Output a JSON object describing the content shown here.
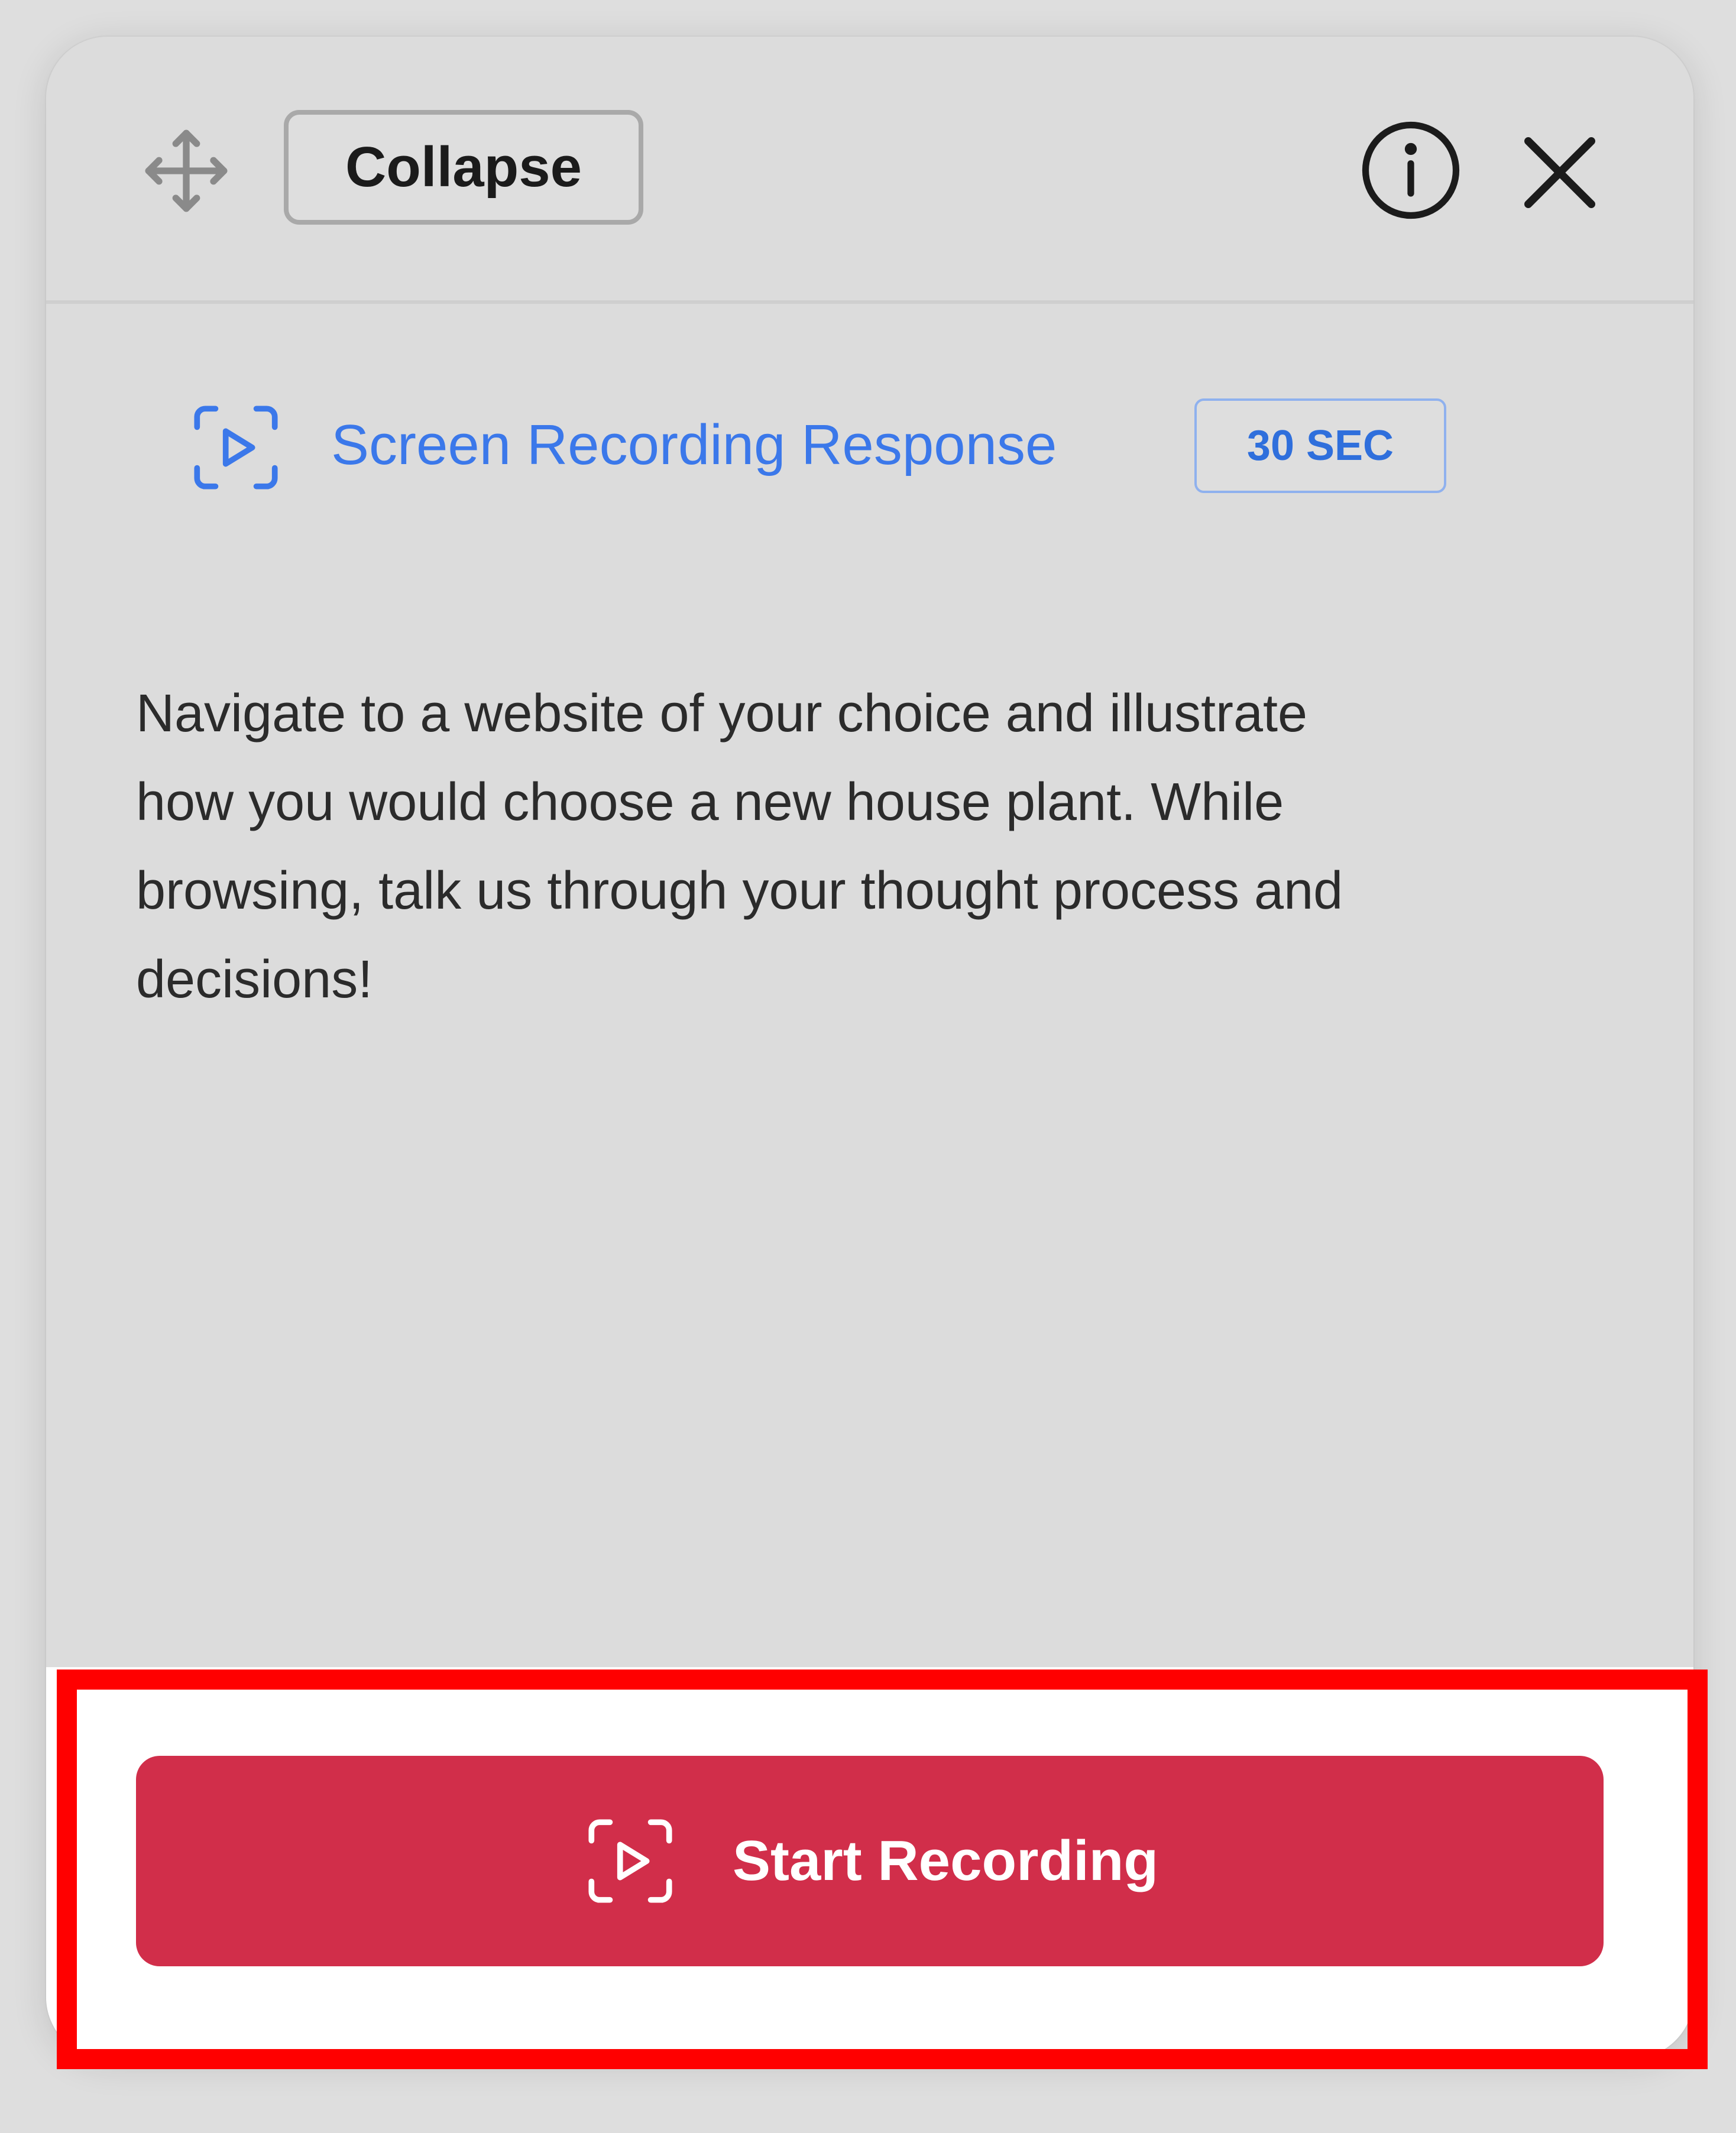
{
  "header": {
    "move_icon": "move-icon",
    "collapse_label": "Collapse",
    "info_icon": "info-icon",
    "close_icon": "close-icon"
  },
  "task": {
    "icon": "screen-recording-icon",
    "title": "Screen Recording Response",
    "duration": "30 SEC",
    "prompt": "Navigate to a website of your choice and illustrate\nhow you would choose a new house plant. While\nbrowsing, talk us through your thought process and\ndecisions!"
  },
  "footer": {
    "start_label": "Start Recording",
    "start_icon": "screen-recording-icon"
  },
  "colors": {
    "accent_blue": "#3b78ea",
    "record_red": "#d12e4a",
    "highlight_red": "#ff0000",
    "panel_bg": "#dcdcdc"
  }
}
